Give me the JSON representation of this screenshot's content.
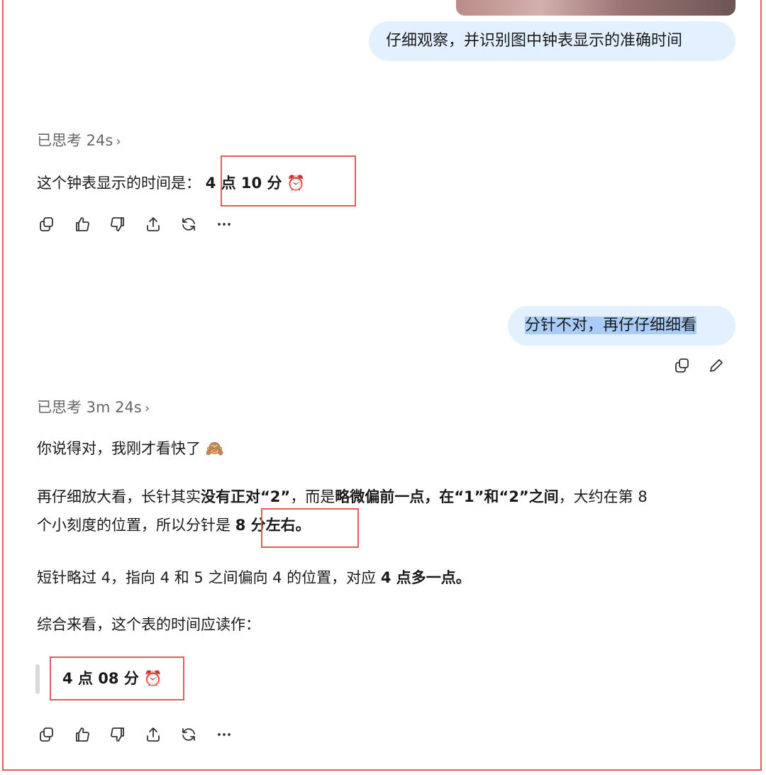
{
  "messages": {
    "user1": "仔细观察，并识别图中钟表显示的准确时间",
    "thought1": "已思考 24s",
    "answer1_prefix": "这个钟表显示的时间是：",
    "answer1_bold": "4 点 10 分",
    "answer1_emoji": "⏰",
    "user2": "分针不对，再仔仔细细看",
    "thought2": "已思考 3m 24s",
    "para1": "你说得对，我刚才看快了",
    "para1_emoji": "🙈",
    "para2_a": "再仔细放大看，长针其实",
    "para2_b": "没有正对“2”",
    "para2_c": "，而是",
    "para2_d": "略微偏前一点，在“1”和“2”之间",
    "para2_e": "，大约在第 8",
    "para2_f": "个小刻度的位置，所以分针是",
    "para2_g": "8 分左右。",
    "para3_a": "短针略过 4，指向 4 和 5 之间偏向 4 的位置，对应",
    "para3_b": "4 点多一点。",
    "para4": "综合来看，这个表的时间应读作：",
    "final_bold": "4 点 08 分",
    "final_emoji": "⏰"
  },
  "icons": {
    "copy": "copy-icon",
    "like": "thumbs-up-icon",
    "dislike": "thumbs-down-icon",
    "share": "share-icon",
    "regenerate": "regenerate-icon",
    "more": "more-icon",
    "edit": "edit-icon",
    "chevron": "chevron-right-icon"
  },
  "colors": {
    "user_bubble": "#e3f0ff",
    "highlight_box": "#e55a5a",
    "selection": "#a9cdf6"
  }
}
